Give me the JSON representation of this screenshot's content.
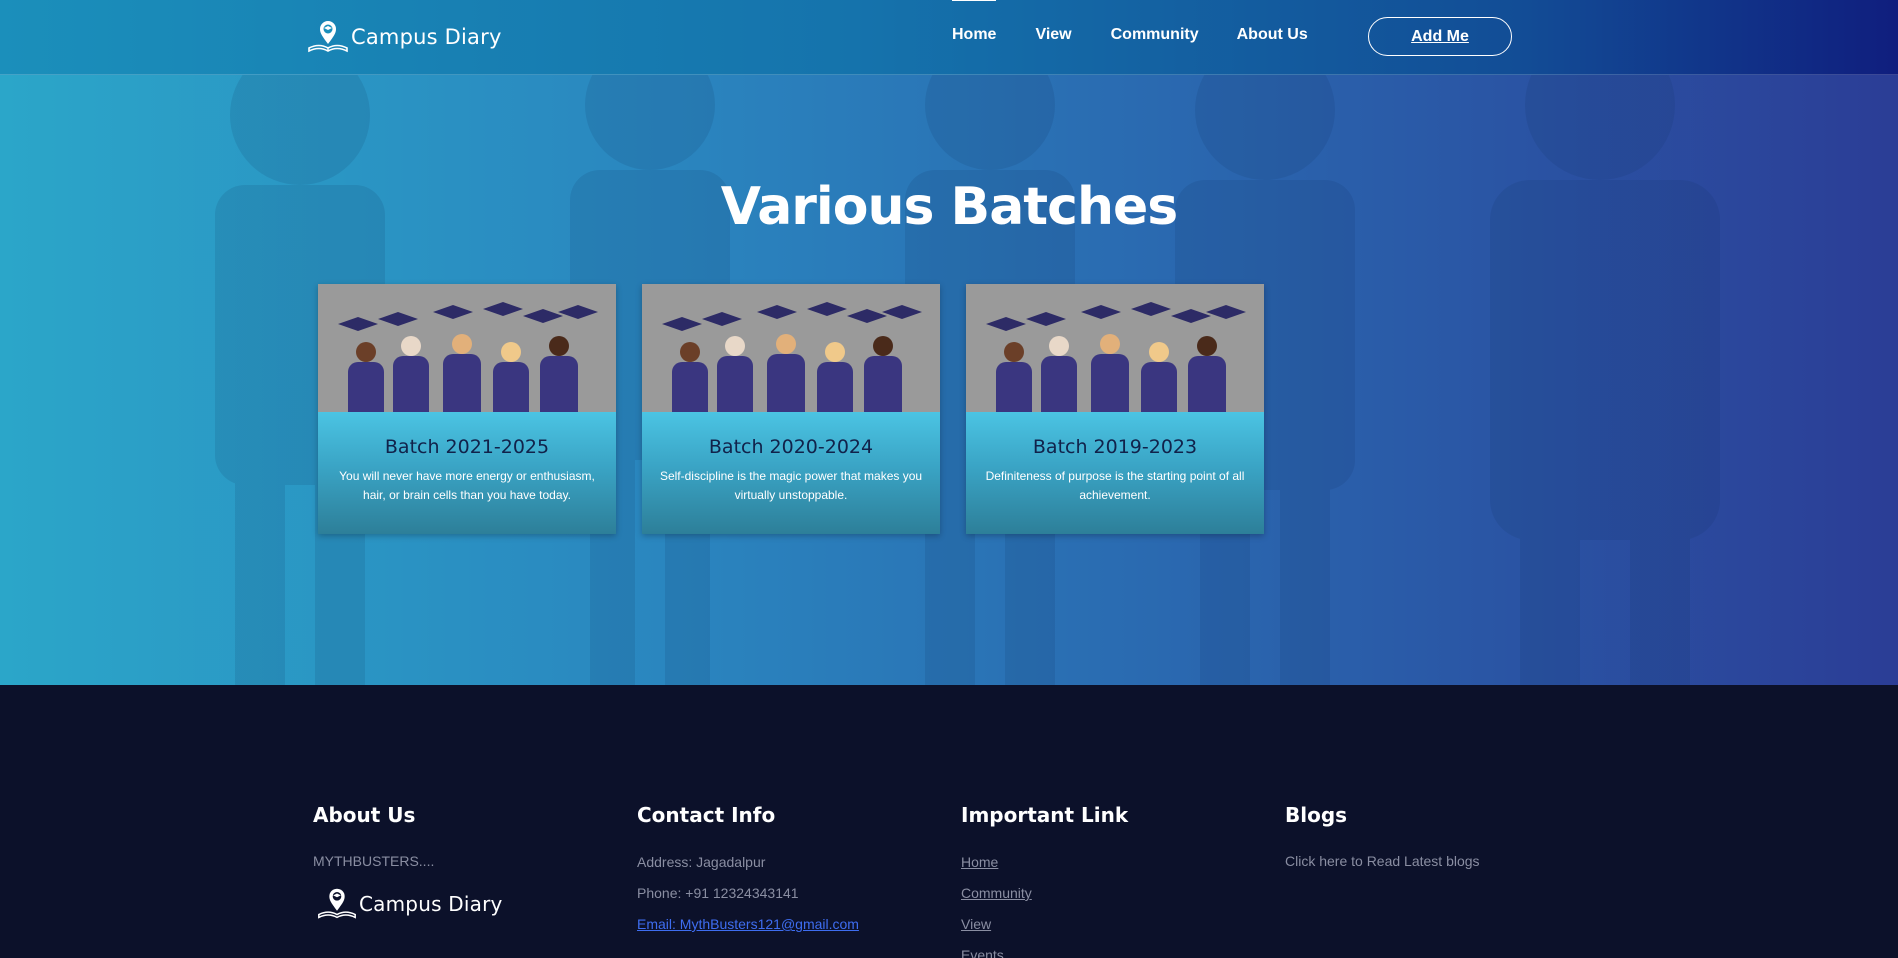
{
  "header": {
    "logo_text": "Campus Diary",
    "nav": [
      {
        "label": "Home",
        "active": true
      },
      {
        "label": "View"
      },
      {
        "label": "Community"
      },
      {
        "label": "About Us"
      }
    ],
    "cta_label": "Add Me"
  },
  "hero": {
    "title": "Various Batches",
    "cards": [
      {
        "title": "Batch 2021-2025",
        "desc": "You will never have more energy or enthusiasm, hair, or brain cells than you have today."
      },
      {
        "title": "Batch 2020-2024",
        "desc": "Self-discipline is the magic power that makes you virtually unstoppable."
      },
      {
        "title": "Batch 2019-2023",
        "desc": "Definiteness of purpose is the starting point of all achievement."
      }
    ]
  },
  "footer": {
    "about": {
      "heading": "About Us",
      "text": "MYTHBUSTERS....",
      "logo_text": "Campus Diary"
    },
    "contact": {
      "heading": "Contact Info",
      "address": "Address: Jagadalpur",
      "phone": "Phone: +91 12324343141",
      "email": "Email: MythBusters121@gmail.com"
    },
    "links": {
      "heading": "Important Link",
      "items": [
        "Home",
        "Community",
        "View",
        "Events"
      ]
    },
    "blogs": {
      "heading": "Blogs",
      "text": "Click here to Read Latest blogs"
    }
  },
  "colors": {
    "header_start": "#1b8fbb",
    "header_end": "#101e7e",
    "footer_bg": "#0c112a",
    "card_title": "#11224a",
    "email_link": "#3e6df0"
  }
}
